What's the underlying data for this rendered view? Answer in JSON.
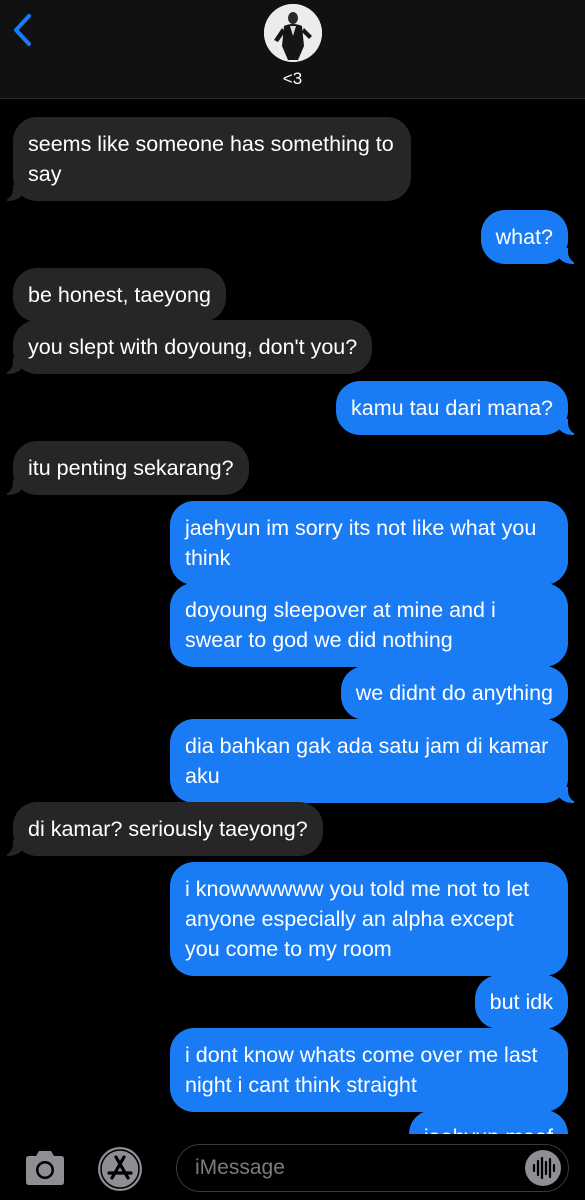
{
  "header": {
    "back_icon": "chevron-left-icon",
    "contact_name": "<3",
    "accent": "#1a7cf5"
  },
  "messages": [
    {
      "from": "received",
      "text": "seems like someone has something to say"
    },
    {
      "from": "sent",
      "text": "what?"
    },
    {
      "from": "received",
      "text": "be honest, taeyong"
    },
    {
      "from": "received",
      "text": "you slept with doyoung, don't you?"
    },
    {
      "from": "sent",
      "text": "kamu tau dari mana?"
    },
    {
      "from": "received",
      "text": "itu penting sekarang?"
    },
    {
      "from": "sent",
      "text": "jaehyun im sorry its not like what you think"
    },
    {
      "from": "sent",
      "text": "doyoung sleepover at mine and i swear to god we did nothing"
    },
    {
      "from": "sent",
      "text": "we didnt do anything"
    },
    {
      "from": "sent",
      "text": "dia bahkan gak ada satu jam di kamar aku"
    },
    {
      "from": "received",
      "text": "di kamar? seriously taeyong?"
    },
    {
      "from": "sent",
      "text": "i knowwwwww you told me not to let anyone especially an alpha except you come to my room"
    },
    {
      "from": "sent",
      "text": "but idk"
    },
    {
      "from": "sent",
      "text": "i dont know whats come over me last night i cant think straight"
    },
    {
      "from": "sent",
      "text": "jaehyun maaf"
    }
  ],
  "composer": {
    "placeholder": "iMessage",
    "camera_icon": "camera-icon",
    "appstore_icon": "app-store-icon",
    "audio_icon": "audio-waveform-icon"
  },
  "colors": {
    "sent_bubble": "#1a7cf5",
    "received_bubble": "#262628",
    "background": "#000000"
  }
}
